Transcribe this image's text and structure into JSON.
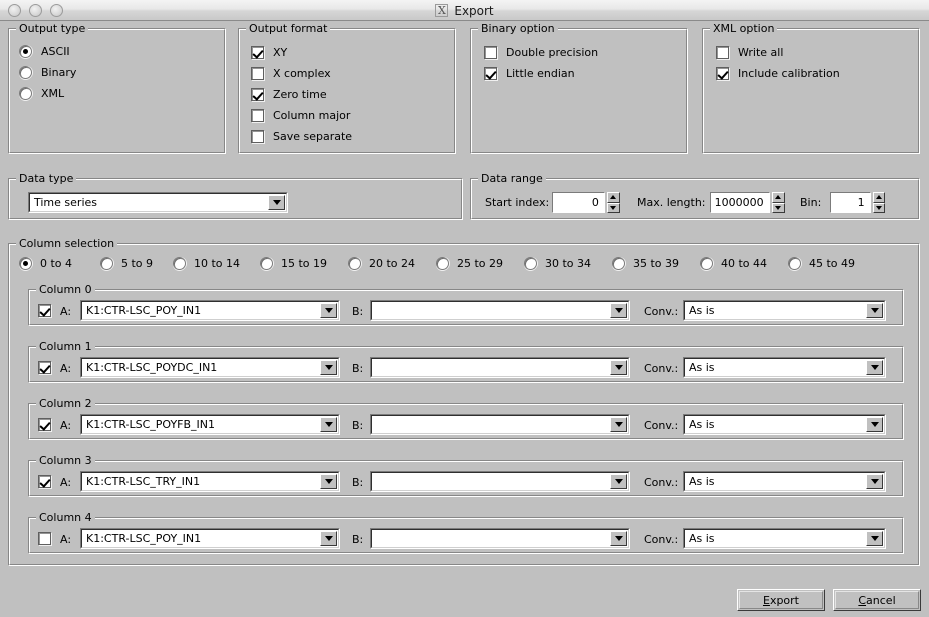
{
  "window": {
    "title": "Export",
    "logo_icon": "x-logo-icon",
    "buttons": [
      "close-button",
      "minimize-button",
      "zoom-button"
    ]
  },
  "output_type": {
    "legend": "Output type",
    "selected": "ASCII",
    "options": [
      {
        "label": "ASCII",
        "checked": true
      },
      {
        "label": "Binary",
        "checked": false
      },
      {
        "label": "XML",
        "checked": false
      }
    ]
  },
  "output_format": {
    "legend": "Output format",
    "options": [
      {
        "label": "XY",
        "checked": true
      },
      {
        "label": "X complex",
        "checked": false
      },
      {
        "label": "Zero time",
        "checked": true
      },
      {
        "label": "Column major",
        "checked": false
      },
      {
        "label": "Save separate",
        "checked": false
      }
    ]
  },
  "binary_option": {
    "legend": "Binary option",
    "options": [
      {
        "label": "Double precision",
        "checked": false
      },
      {
        "label": "Little endian",
        "checked": true
      }
    ]
  },
  "xml_option": {
    "legend": "XML option",
    "options": [
      {
        "label": "Write all",
        "checked": false
      },
      {
        "label": "Include calibration",
        "checked": true
      }
    ]
  },
  "data_type": {
    "legend": "Data type",
    "value": "Time series",
    "dropdown_icon": "chevron-down-icon"
  },
  "data_range": {
    "legend": "Data range",
    "start_index": {
      "label": "Start index:",
      "value": "0"
    },
    "max_length": {
      "label": "Max. length:",
      "value": "1000000"
    },
    "bin": {
      "label": "Bin:",
      "value": "1"
    }
  },
  "column_selection": {
    "legend": "Column selection",
    "ranges": [
      {
        "label": "0 to 4",
        "checked": true
      },
      {
        "label": "5 to 9",
        "checked": false
      },
      {
        "label": "10 to 14",
        "checked": false
      },
      {
        "label": "15 to 19",
        "checked": false
      },
      {
        "label": "20 to 24",
        "checked": false
      },
      {
        "label": "25 to 29",
        "checked": false
      },
      {
        "label": "30 to 34",
        "checked": false
      },
      {
        "label": "35 to 39",
        "checked": false
      },
      {
        "label": "40 to 44",
        "checked": false
      },
      {
        "label": "45 to 49",
        "checked": false
      }
    ],
    "field_labels": {
      "a": "A:",
      "b": "B:",
      "conv": "Conv.:"
    },
    "columns": [
      {
        "legend": "Column 0",
        "enabled": true,
        "a_value": "K1:CTR-LSC_POY_IN1",
        "b_value": "",
        "conv_value": "As is"
      },
      {
        "legend": "Column 1",
        "enabled": true,
        "a_value": "K1:CTR-LSC_POYDC_IN1",
        "b_value": "",
        "conv_value": "As is"
      },
      {
        "legend": "Column 2",
        "enabled": true,
        "a_value": "K1:CTR-LSC_POYFB_IN1",
        "b_value": "",
        "conv_value": "As is"
      },
      {
        "legend": "Column 3",
        "enabled": true,
        "a_value": "K1:CTR-LSC_TRY_IN1",
        "b_value": "",
        "conv_value": "As is"
      },
      {
        "legend": "Column 4",
        "enabled": false,
        "a_value": "K1:CTR-LSC_POY_IN1",
        "b_value": "",
        "conv_value": "As is"
      }
    ]
  },
  "actions": {
    "export": {
      "prefix": "",
      "mnemonic": "E",
      "suffix": "xport"
    },
    "cancel": {
      "prefix": "",
      "mnemonic": "C",
      "suffix": "ancel"
    }
  },
  "colors": {
    "background": "#c0c0c0",
    "field_background": "#ffffff",
    "text": "#000000",
    "titlebar_text": "#1a1a1a"
  }
}
